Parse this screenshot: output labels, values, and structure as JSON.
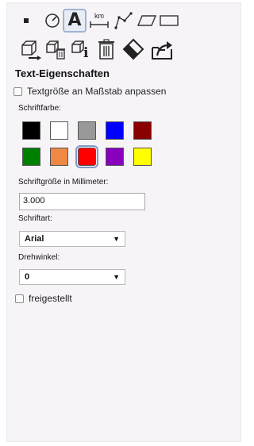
{
  "toolbar": {
    "row1": [
      {
        "icon": "point-icon"
      },
      {
        "icon": "circle-tool-icon"
      },
      {
        "icon": "text-tool-icon",
        "label": "A",
        "active": true
      },
      {
        "icon": "measure-distance-icon",
        "label": "km"
      },
      {
        "icon": "polyline-icon"
      },
      {
        "icon": "polygon-icon"
      },
      {
        "icon": "rectangle-icon"
      }
    ],
    "row2": [
      {
        "icon": "move-object-icon"
      },
      {
        "icon": "delete-object-icon"
      },
      {
        "icon": "object-info-icon",
        "label": "i"
      },
      {
        "icon": "trash-icon"
      },
      {
        "icon": "eraser-icon"
      },
      {
        "icon": "export-icon"
      }
    ]
  },
  "panel": {
    "title": "Text-Eigenschaften",
    "scale_checkbox_label": "Textgröße an Maßstab anpassen",
    "scale_checkbox_checked": false,
    "color_label": "Schriftfarbe:",
    "colors": [
      "#000000",
      "#ffffff",
      "#999999",
      "#0000ff",
      "#880000",
      "#008000",
      "#ee8844",
      "#ff0000",
      "#8800bb",
      "#ffff00"
    ],
    "selected_color": "#ff0000",
    "size_label": "Schriftgröße in Millimeter:",
    "size_value": "3.000",
    "font_label": "Schriftart:",
    "font_value": "Arial",
    "rotation_label": "Drehwinkel:",
    "rotation_value": "0",
    "free_checkbox_label": "freigestellt",
    "free_checkbox_checked": false
  }
}
